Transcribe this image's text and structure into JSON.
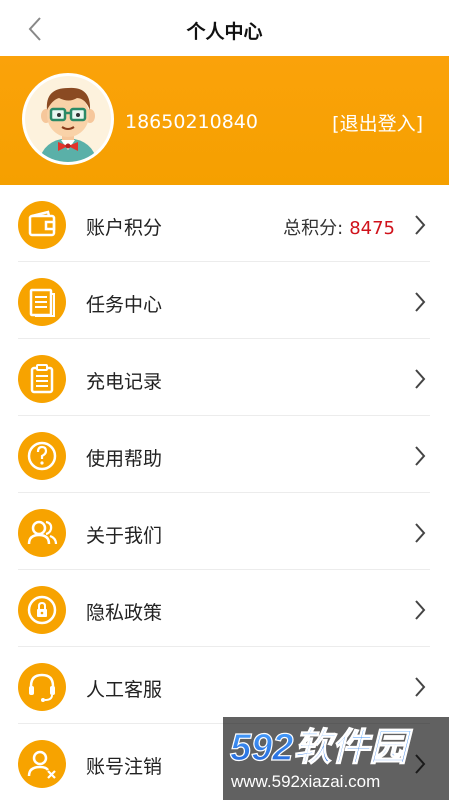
{
  "navbar": {
    "title": "个人中心"
  },
  "profile": {
    "phone": "18650210840",
    "logout_label": "[退出登入]"
  },
  "menu": {
    "items": [
      {
        "label": "账户积分",
        "icon": "wallet-icon",
        "extra_label": "总积分:",
        "extra_value": "8475"
      },
      {
        "label": "任务中心",
        "icon": "task-list-icon"
      },
      {
        "label": "充电记录",
        "icon": "clipboard-icon"
      },
      {
        "label": "使用帮助",
        "icon": "help-icon"
      },
      {
        "label": "关于我们",
        "icon": "users-icon"
      },
      {
        "label": "隐私政策",
        "icon": "lock-icon"
      },
      {
        "label": "人工客服",
        "icon": "headset-icon"
      },
      {
        "label": "账号注销",
        "icon": "user-remove-icon"
      }
    ]
  },
  "watermark": {
    "brand": "592软件园",
    "url": "www.592xiazai.com"
  },
  "colors": {
    "accent": "#f7a300",
    "points_value": "#d0121b"
  }
}
